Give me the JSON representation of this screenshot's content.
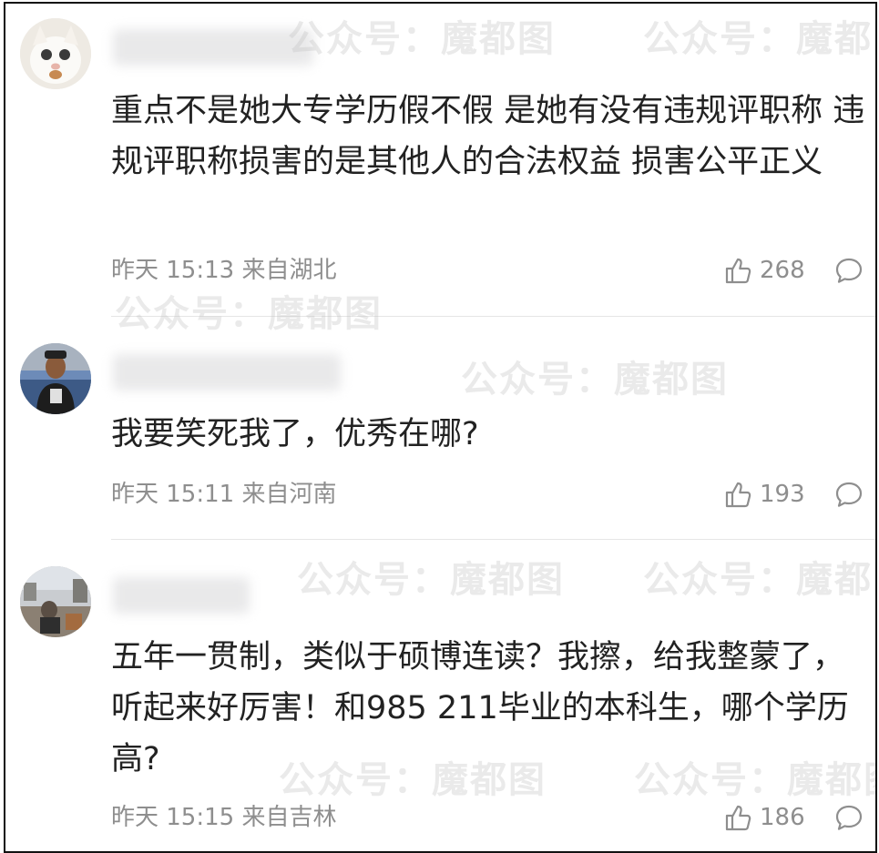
{
  "comments": [
    {
      "avatar": "cat-avatar",
      "content": "重点不是她大专学历假不假 是她有没有违规评职称 违规评职称损害的是其他人的合法权益 损害公平正义",
      "time": "昨天 15:13 来自湖北",
      "likes": "268"
    },
    {
      "avatar": "man-avatar",
      "content": "我要笑死我了，优秀在哪?",
      "time": "昨天 15:11 来自河南",
      "likes": "193"
    },
    {
      "avatar": "street-avatar",
      "content": "五年一贯制，类似于硕博连读？我擦，给我整蒙了，听起来好厉害！和985 211毕业的本科生，哪个学历高?",
      "time": "昨天 15:15 来自吉林",
      "likes": "186"
    }
  ],
  "watermark": "公众号：魔都图",
  "colors": {
    "text": "#222222",
    "meta": "#8e8e8e",
    "divider": "#e6e6e6"
  },
  "icons": [
    "thumbs-up-icon",
    "comment-bubble-icon"
  ]
}
